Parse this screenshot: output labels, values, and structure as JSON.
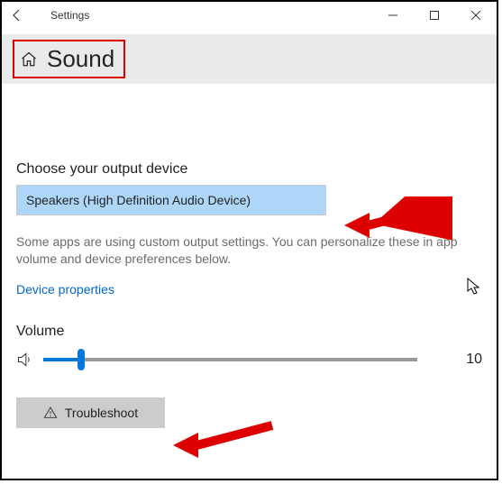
{
  "window": {
    "app_title": "Settings",
    "page_title": "Sound"
  },
  "output": {
    "label": "Choose your output device",
    "selected": "Speakers (High Definition Audio Device)",
    "hint": "Some apps are using custom output settings. You can personalize these in app volume and device preferences below.",
    "properties_link": "Device properties"
  },
  "volume": {
    "label": "Volume",
    "value": "10",
    "percent": 10
  },
  "troubleshoot": {
    "label": "Troubleshoot"
  },
  "colors": {
    "accent": "#0078d7",
    "highlight": "#d00",
    "selected_bg": "#aed6f8"
  }
}
